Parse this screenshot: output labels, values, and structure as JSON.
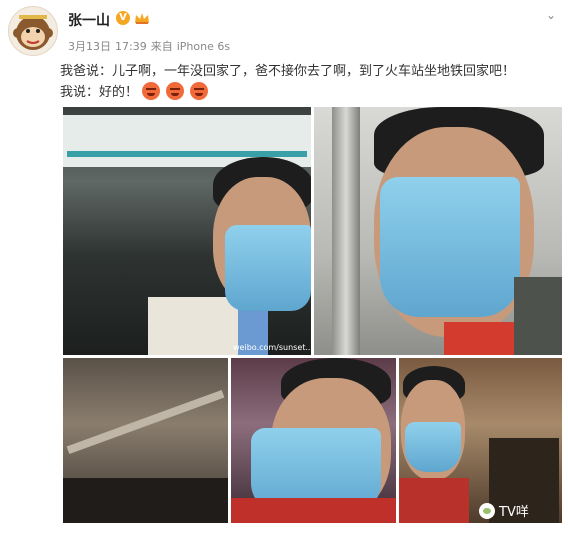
{
  "post": {
    "author": "张一山",
    "verified_badge": "V",
    "date": "3月13日",
    "time": "17:39",
    "source_prefix": "来自",
    "source": "iPhone 6s",
    "line1": "我爸说：儿子啊，一年没回家了，爸不接你去了啊，到了火车站坐地铁回家吧！",
    "line2": "我说：好的！",
    "photo_watermark": "weibo.com/sunset...",
    "watermark": "TV咩"
  },
  "icons": {
    "avatar": "monkey-avatar-icon",
    "crown": "vip-crown-icon",
    "chevron": "chevron-down-icon",
    "emoji": "angry-face-icon"
  },
  "colors": {
    "badge": "#f5a623",
    "emoji": "#f06a3a",
    "mask": "#8fd0ec"
  }
}
